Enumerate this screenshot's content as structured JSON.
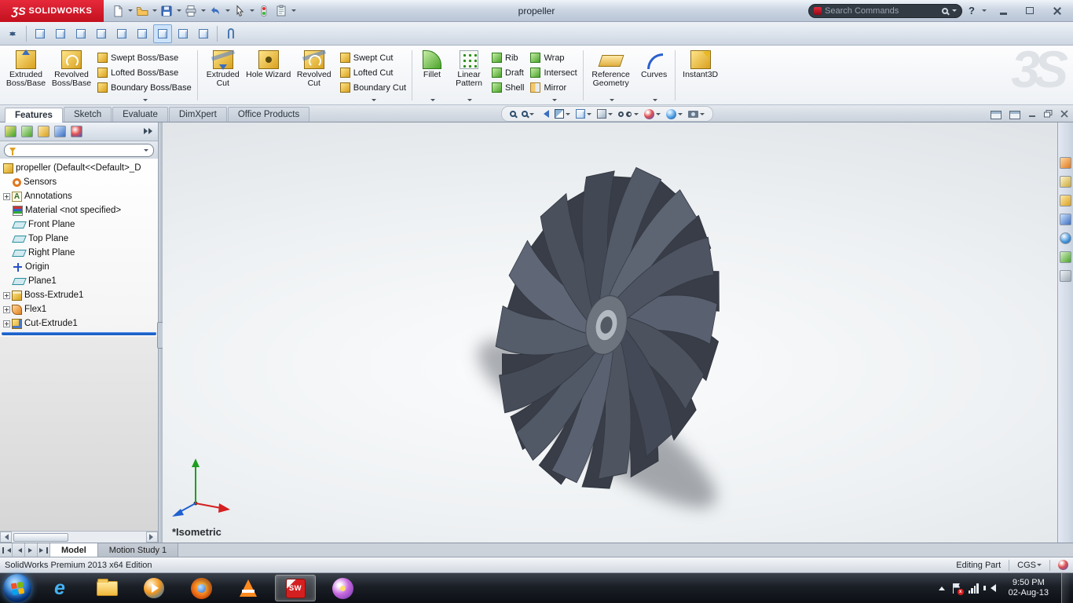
{
  "titlebar": {
    "logo_glyph": "ƷS",
    "logo": "SOLIDWORKS",
    "title": "propeller",
    "search_placeholder": "Search Commands",
    "help": "?"
  },
  "ribbon": {
    "tabs": [
      {
        "label": "Features"
      },
      {
        "label": "Sketch"
      },
      {
        "label": "Evaluate"
      },
      {
        "label": "DimXpert"
      },
      {
        "label": "Office Products"
      }
    ],
    "buttons": {
      "extruded_boss": "Extruded Boss/Base",
      "revolved_boss": "Revolved Boss/Base",
      "swept_boss": "Swept Boss/Base",
      "lofted_boss": "Lofted Boss/Base",
      "boundary_boss": "Boundary Boss/Base",
      "extruded_cut": "Extruded Cut",
      "hole_wizard": "Hole Wizard",
      "revolved_cut": "Revolved Cut",
      "swept_cut": "Swept Cut",
      "lofted_cut": "Lofted Cut",
      "boundary_cut": "Boundary Cut",
      "fillet": "Fillet",
      "linear_pattern": "Linear Pattern",
      "rib": "Rib",
      "draft": "Draft",
      "shell": "Shell",
      "wrap": "Wrap",
      "intersect": "Intersect",
      "mirror": "Mirror",
      "reference_geometry": "Reference Geometry",
      "curves": "Curves",
      "instant3d": "Instant3D"
    },
    "watermark": "3S"
  },
  "feature_tree": {
    "annotation_glyph": "A",
    "items": [
      {
        "label": "propeller (Default<<Default>_D"
      },
      {
        "label": "Sensors"
      },
      {
        "label": "Annotations"
      },
      {
        "label": "Material <not specified>"
      },
      {
        "label": "Front Plane"
      },
      {
        "label": "Top Plane"
      },
      {
        "label": "Right Plane"
      },
      {
        "label": "Origin"
      },
      {
        "label": "Plane1"
      },
      {
        "label": "Boss-Extrude1"
      },
      {
        "label": "Flex1"
      },
      {
        "label": "Cut-Extrude1"
      }
    ]
  },
  "viewport": {
    "view_label": "*Isometric"
  },
  "document_tabs": [
    {
      "label": "Model"
    },
    {
      "label": "Motion Study 1"
    }
  ],
  "statusbar": {
    "edition": "SolidWorks Premium 2013 x64 Edition",
    "mode": "Editing Part",
    "units": "CGS"
  },
  "taskbar": {
    "time": "9:50 PM",
    "date": "02-Aug-13"
  },
  "icons": {
    "ie_glyph": "e",
    "solidworks_glyph": "SW"
  }
}
